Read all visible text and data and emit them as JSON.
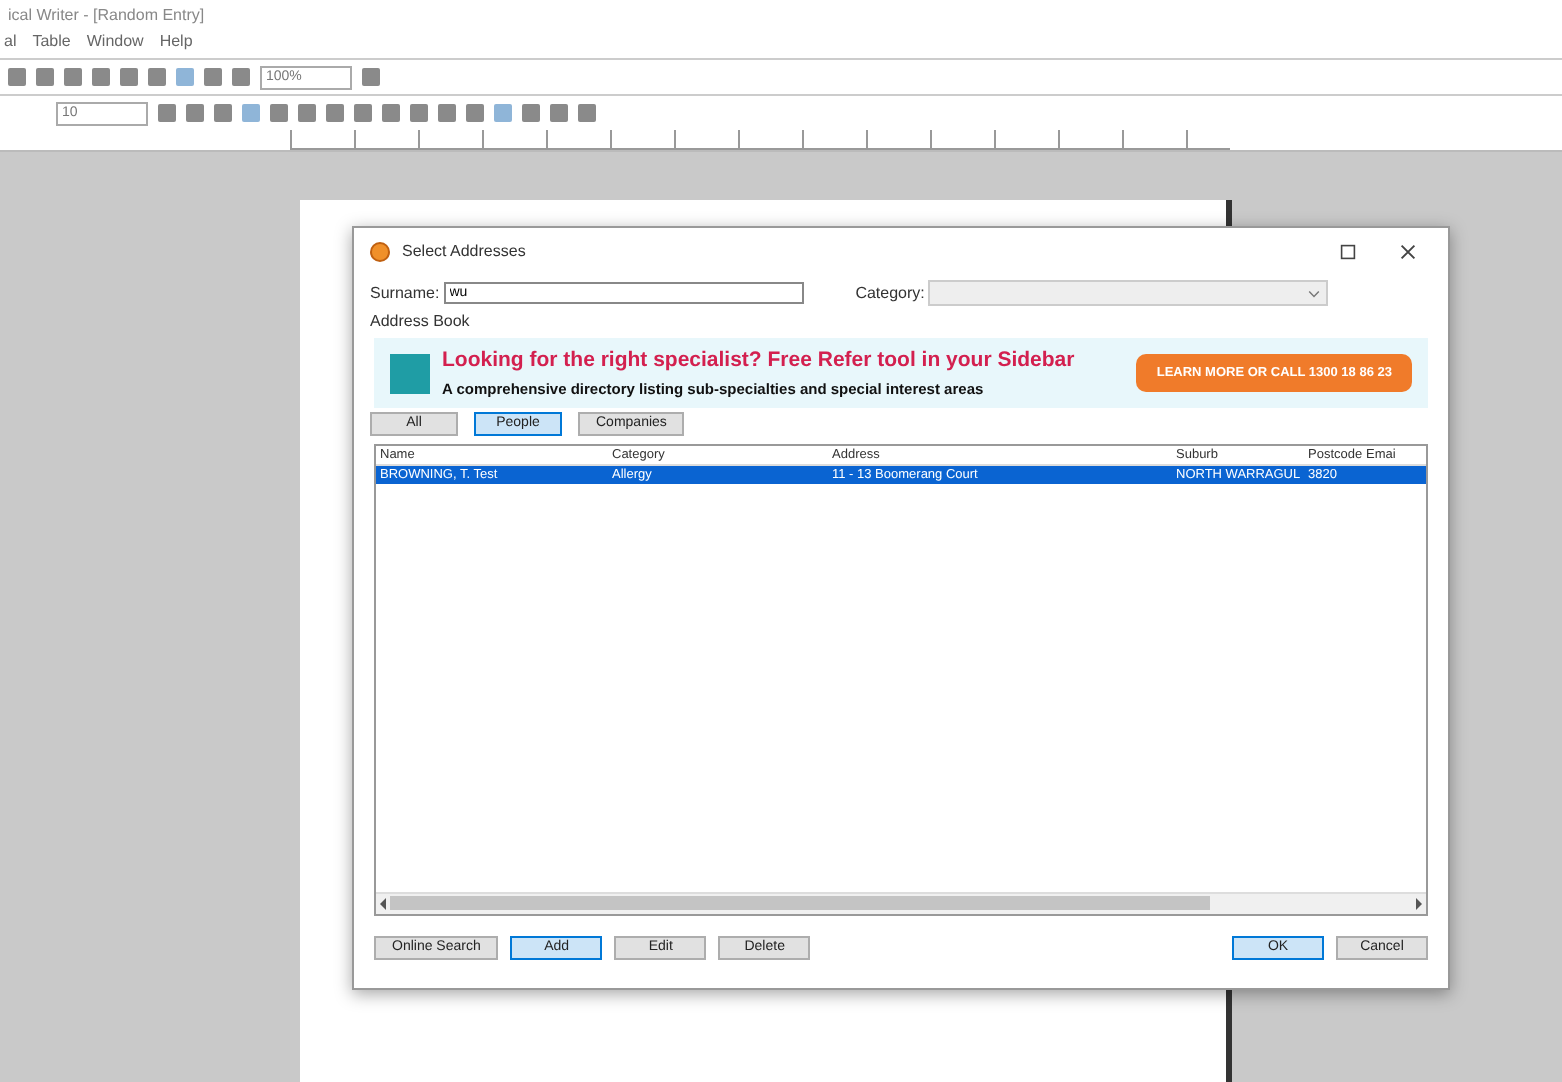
{
  "window": {
    "title": "ical Writer - [Random Entry]"
  },
  "menu": [
    "al",
    "Table",
    "Window",
    "Help"
  ],
  "toolbar": {
    "zoom": "100%"
  },
  "format_toolbar": {
    "size": "10"
  },
  "dialog": {
    "title": "Select Addresses",
    "surname": {
      "label": "Surname:",
      "value": "wu"
    },
    "category": {
      "label": "Category:"
    },
    "group_label": "Address Book",
    "banner": {
      "headline": "Looking for the right specialist? Free Refer tool in your Sidebar",
      "subline": "A comprehensive directory listing sub-specialties and special interest areas",
      "button": "LEARN MORE OR CALL 1300 18 86 23"
    },
    "filters": [
      {
        "label": "All",
        "selected": false
      },
      {
        "label": "People",
        "selected": true
      },
      {
        "label": "Companies",
        "selected": false
      }
    ],
    "table": {
      "columns": [
        "Name",
        "Category",
        "Address",
        "Suburb",
        "Postcode",
        "Emai"
      ],
      "rows": [
        {
          "cells": [
            "BROWNING, T. Test",
            "Allergy",
            "11 - 13 Boomerang Court",
            "NORTH WARRAGUL",
            "3820"
          ],
          "selected": true
        }
      ]
    },
    "left_buttons": [
      {
        "label": "Online Search",
        "default": false
      },
      {
        "label": "Add",
        "default": true
      },
      {
        "label": "Edit",
        "default": false
      },
      {
        "label": "Delete",
        "default": false
      }
    ],
    "right_buttons": [
      {
        "label": "OK",
        "default": true
      },
      {
        "label": "Cancel",
        "default": false
      }
    ]
  }
}
